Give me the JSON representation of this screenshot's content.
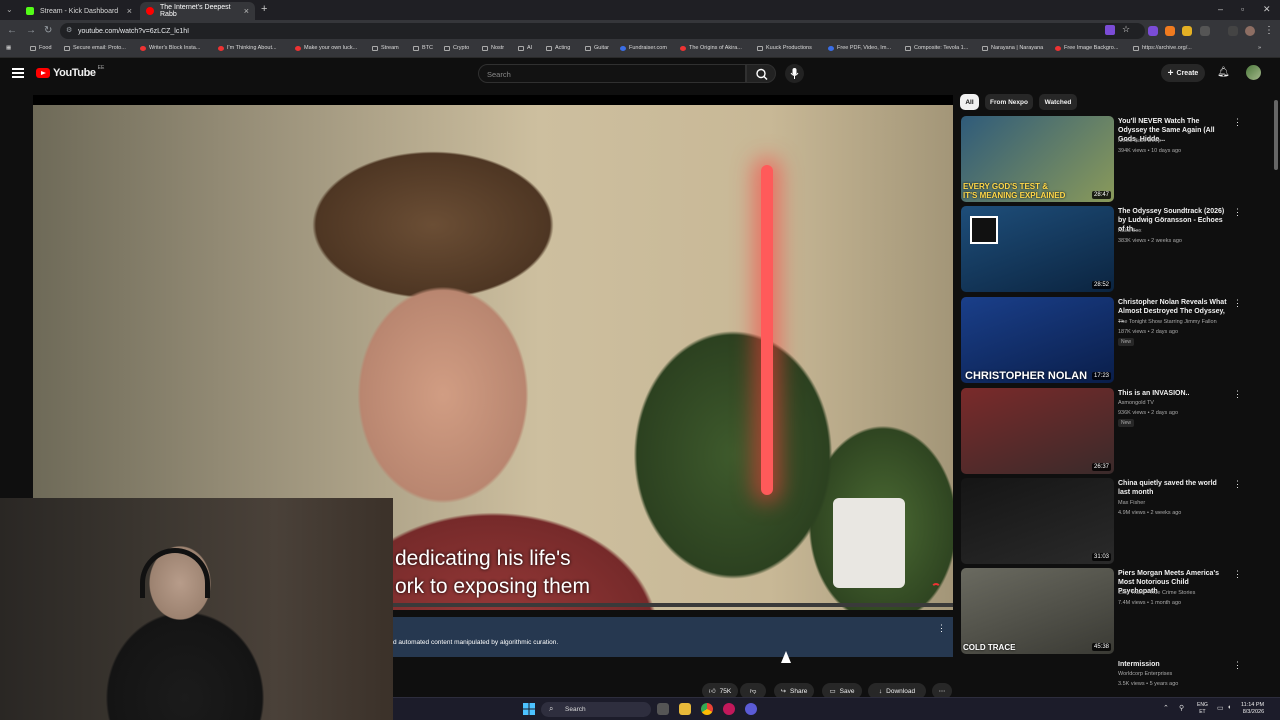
{
  "browser": {
    "tabs": [
      {
        "title": "Stream - Kick Dashboard",
        "active": false,
        "favicon_color": "#53fc18"
      },
      {
        "title": "The Internet's Deepest Rabb",
        "active": true,
        "favicon_color": "#ff0000"
      }
    ],
    "new_tab": "+",
    "url": "youtube.com/watch?v=6zLCZ_lc1hI",
    "bookmarks": [
      {
        "label": "Food",
        "kind": "folder"
      },
      {
        "label": "Secure email: Proto...",
        "kind": "site"
      },
      {
        "label": "Writer's Block Insta...",
        "kind": "yt"
      },
      {
        "label": "I'm Thinking About...",
        "kind": "yt"
      },
      {
        "label": "Make your own luck...",
        "kind": "yt"
      },
      {
        "label": "Stream",
        "kind": "folder"
      },
      {
        "label": "BTC",
        "kind": "folder"
      },
      {
        "label": "Crypto",
        "kind": "folder"
      },
      {
        "label": "Nostr",
        "kind": "folder"
      },
      {
        "label": "AI",
        "kind": "folder"
      },
      {
        "label": "Acting",
        "kind": "folder"
      },
      {
        "label": "Guitar",
        "kind": "folder"
      },
      {
        "label": "Fundraiser.com",
        "kind": "blue"
      },
      {
        "label": "The Origins of Akira...",
        "kind": "yt"
      },
      {
        "label": "Kuuck Productions",
        "kind": "folder"
      },
      {
        "label": "Free PDF, Video, Im...",
        "kind": "blue"
      },
      {
        "label": "Composite: Tevola 1...",
        "kind": "site"
      },
      {
        "label": "Narayana | Narayana",
        "kind": "site"
      },
      {
        "label": "Free Image Backgro...",
        "kind": "yt"
      },
      {
        "label": "https://archive.org/...",
        "kind": "site"
      }
    ]
  },
  "youtube": {
    "logo_text": "YouTube",
    "logo_country": "EE",
    "search_placeholder": "Search",
    "create_label": "Create"
  },
  "player": {
    "caption_line1": "dedicating his life's",
    "caption_line2": "ork to exposing them",
    "banner_text": "d automated content manipulated by algorithmic curation.",
    "likes": "75K",
    "share_label": "Share",
    "save_label": "Save",
    "download_label": "Download"
  },
  "chips": [
    "All",
    "From Nexpo",
    "Watched"
  ],
  "recommendations": [
    {
      "title": "You'll NEVER Watch The Odyssey the Same Again (All Gods, Hidde...",
      "channel": "Movie Balls Deep",
      "meta": "394K views • 10 days ago",
      "duration": "28:47",
      "thumb_text": "EVERY GOD'S TEST &\nIT'S MEANING EXPLAINED",
      "badge": "",
      "thumb_colors": [
        "#2f5b7a",
        "#8a9a5a"
      ]
    },
    {
      "title": "The Odyssey Soundtrack (2026) by Ludwig Göransson - Echoes of th...",
      "channel": "Kaka Box",
      "meta": "383K views • 2 weeks ago",
      "duration": "28:52",
      "thumb_text": "",
      "badge": "",
      "thumb_colors": [
        "#1e4e7a",
        "#0b2440"
      ]
    },
    {
      "title": "Christopher Nolan Reveals What Almost Destroyed The Odyssey, ...",
      "channel": "The Tonight Show Starring Jimmy Fallon",
      "meta": "187K views • 2 days ago",
      "duration": "17:23",
      "thumb_text": "CHRISTOPHER NOLAN",
      "badge": "New",
      "thumb_colors": [
        "#1a3f8a",
        "#0a1e4a"
      ]
    },
    {
      "title": "This is an INVASION..",
      "channel": "Asmongold TV",
      "meta": "936K views • 2 days ago",
      "duration": "26:37",
      "thumb_text": "",
      "badge": "New",
      "thumb_colors": [
        "#7a2a2a",
        "#3a2a2a"
      ]
    },
    {
      "title": "China quietly saved the world last month",
      "channel": "Max Fisher",
      "meta": "4.9M views • 2 weeks ago",
      "duration": "31:03",
      "thumb_text": "",
      "badge": "",
      "thumb_colors": [
        "#151515",
        "#2a2a2a"
      ]
    },
    {
      "title": "Piers Morgan Meets America's Most Notorious Child Psychopath",
      "channel": "Cold Trace - True Crime Stories",
      "meta": "7.4M views • 1 month ago",
      "duration": "45:38",
      "thumb_text": "COLD TRACE",
      "badge": "",
      "thumb_colors": [
        "#6a6a60",
        "#3a3a34"
      ]
    },
    {
      "title": "Intermission",
      "channel": "Worldcorp Enterprises",
      "meta": "3.5K views • 5 years ago",
      "duration": "",
      "thumb_text": "",
      "badge": "",
      "thumb_colors": [
        "#0f0f0f",
        "#0f0f0f"
      ]
    }
  ],
  "taskbar": {
    "search_placeholder": "Search",
    "lang_top": "ENG",
    "lang_bottom": "ET",
    "time": "11:14 PM",
    "date": "8/3/2026"
  }
}
